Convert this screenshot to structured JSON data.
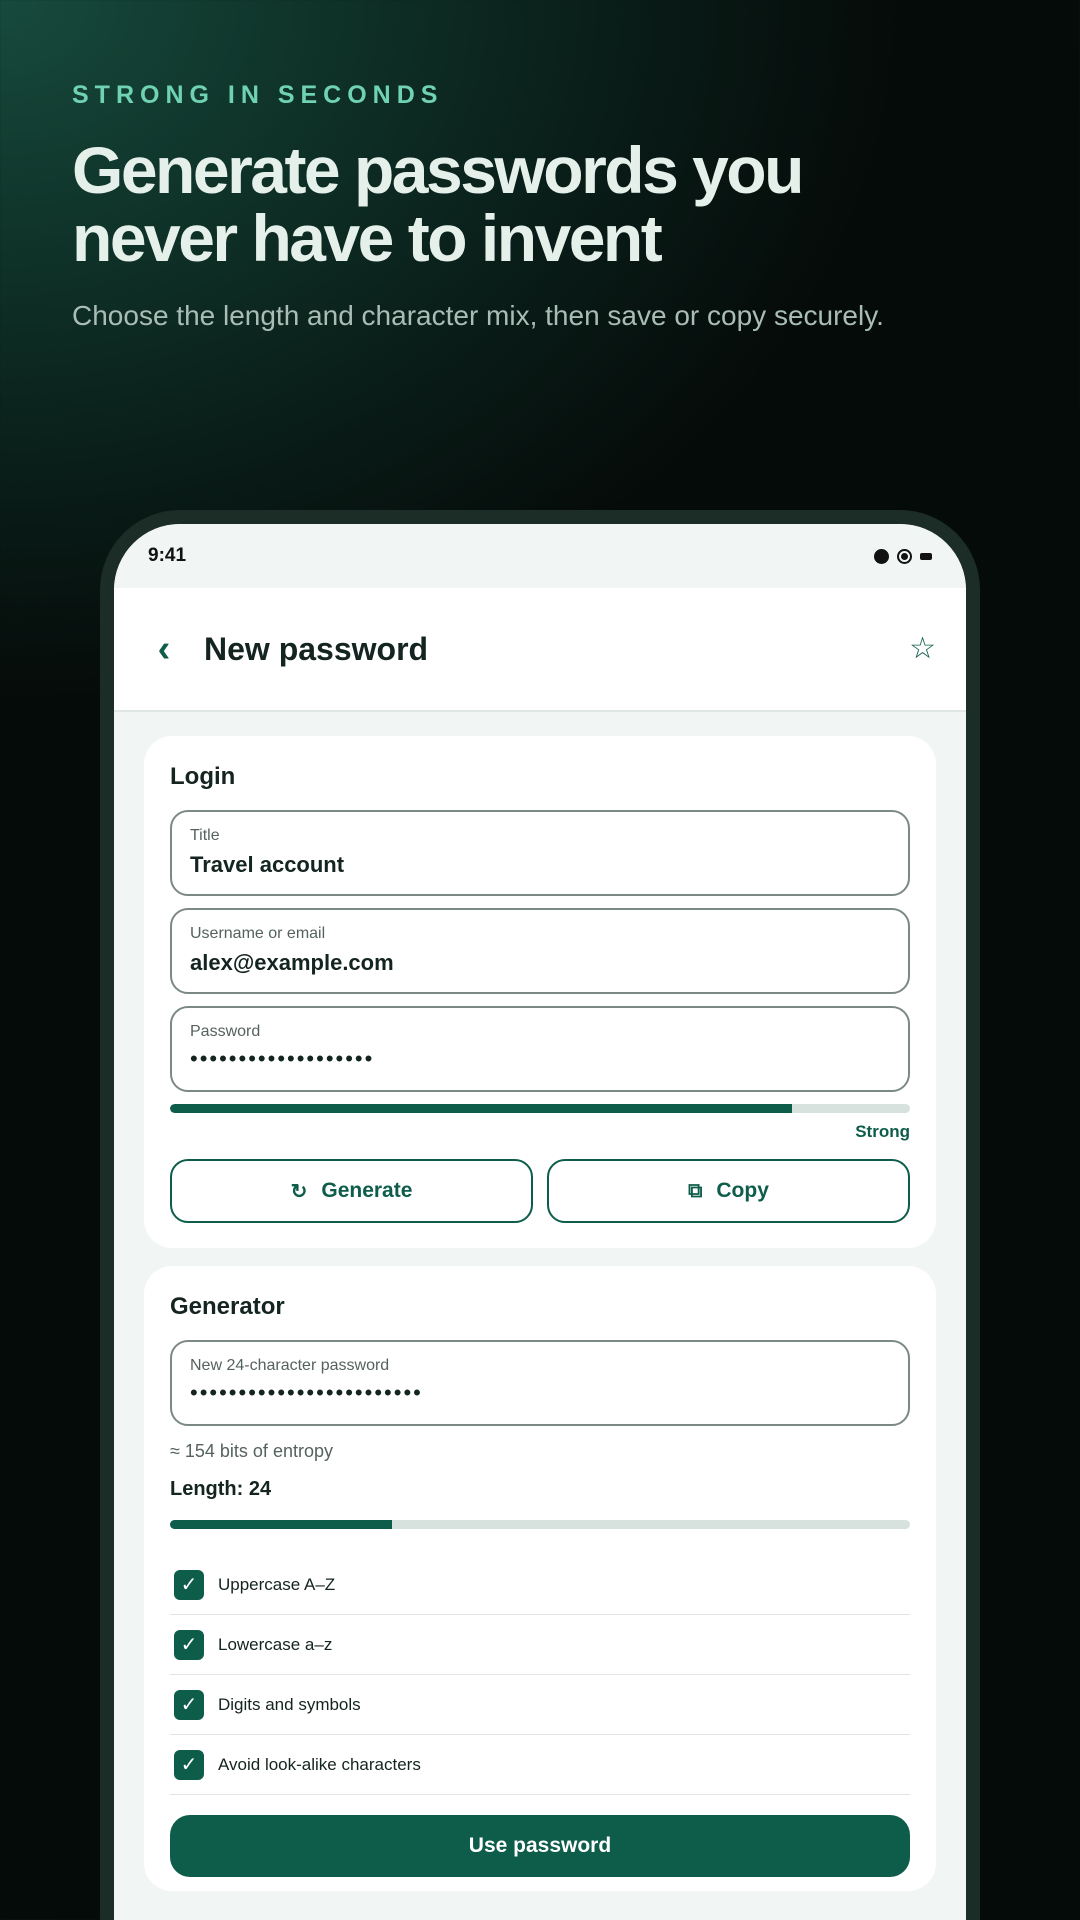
{
  "hero": {
    "eyebrow": "STRONG IN SECONDS",
    "headline": "Generate passwords you never have to invent",
    "subline": "Choose the length and character mix, then save or copy securely."
  },
  "status_bar": {
    "time": "9:41"
  },
  "app_bar": {
    "back_icon": "‹",
    "title": "New password",
    "star_icon": "☆"
  },
  "login": {
    "heading": "Login",
    "title_field": {
      "label": "Title",
      "value": "Travel account"
    },
    "username_field": {
      "label": "Username or email",
      "value": "alex@example.com"
    },
    "password_field": {
      "label": "Password",
      "value": "•••••••••••••••••••"
    },
    "strength": {
      "label": "Strong",
      "fraction": 0.84
    },
    "generate_label": "Generate",
    "generate_icon": "↻",
    "copy_label": "Copy",
    "copy_icon": "⧉"
  },
  "generator": {
    "heading": "Generator",
    "new_password": {
      "label": "New 24-character password",
      "value": "••••••••••••••••••••••••"
    },
    "entropy": "≈ 154 bits of entropy",
    "length_label": "Length: 24",
    "length_fraction": 0.3,
    "options": [
      {
        "label": "Uppercase A–Z",
        "checked": true
      },
      {
        "label": "Lowercase a–z",
        "checked": true
      },
      {
        "label": "Digits and symbols",
        "checked": true
      },
      {
        "label": "Avoid look-alike characters",
        "checked": true
      }
    ],
    "check_glyph": "✓",
    "use_button": "Use password"
  },
  "colors": {
    "accent": "#0e5c4a",
    "eyebrow": "#6fd2b0"
  }
}
